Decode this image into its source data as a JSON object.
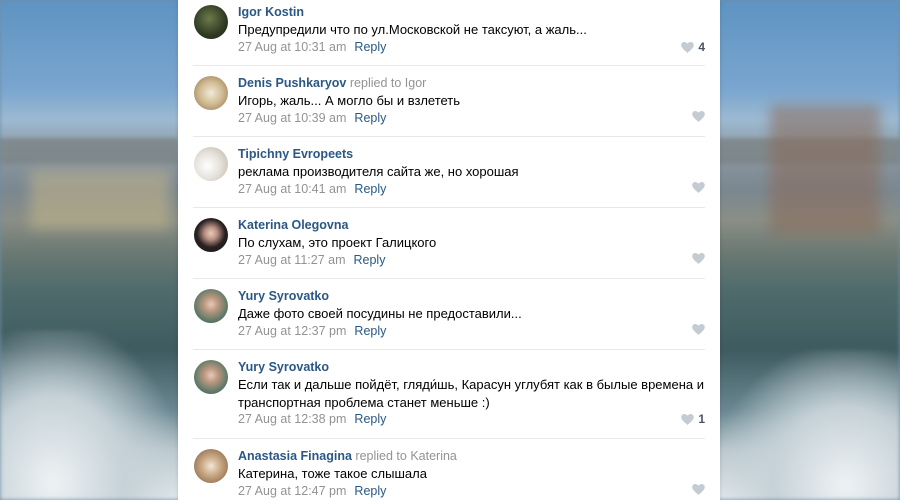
{
  "comments": [
    {
      "author": "Igor Kostin",
      "replied": "",
      "text": "Предупредили что по ул.Московской не таксуют, а жаль...",
      "time": "27 Aug at 10:31 am",
      "reply": "Reply",
      "likes": "4",
      "avatar_color": "#3a4a2a"
    },
    {
      "author": "Denis Pushkaryov",
      "replied": "replied to Igor",
      "text": "Игорь, жаль... А могло бы и взлететь",
      "time": "27 Aug at 10:39 am",
      "reply": "Reply",
      "likes": "",
      "avatar_color": "#b89a6a"
    },
    {
      "author": "Tipichny Evropeets",
      "replied": "",
      "text": "реклама производителя сайта же, но хорошая",
      "time": "27 Aug at 10:41 am",
      "reply": "Reply",
      "likes": "",
      "avatar_color": "#d9d6cf"
    },
    {
      "author": "Katerina Olegovna",
      "replied": "",
      "text": "По слухам, это проект Галицкого",
      "time": "27 Aug at 11:27 am",
      "reply": "Reply",
      "likes": "",
      "avatar_color": "#2b2b2b"
    },
    {
      "author": "Yury Syrovatko",
      "replied": "",
      "text": "Даже фото своей посудины не предоставили...",
      "time": "27 Aug at 12:37 pm",
      "reply": "Reply",
      "likes": "",
      "avatar_color": "#5f7a68"
    },
    {
      "author": "Yury Syrovatko",
      "replied": "",
      "text": "Если так и дальше пойдёт, гляди́шь, Карасун углубят как в былые времена и транспортная проблема станет меньше :)",
      "time": "27 Aug at 12:38 pm",
      "reply": "Reply",
      "likes": "1",
      "avatar_color": "#5f7a68"
    },
    {
      "author": "Anastasia Finagina",
      "replied": "replied to Katerina",
      "text": "Катерина, тоже такое слышала",
      "time": "27 Aug at 12:47 pm",
      "reply": "Reply",
      "likes": "",
      "avatar_color": "#8a6d52"
    }
  ],
  "icons": {
    "like": "heart-icon"
  },
  "colors": {
    "link": "#2a5885",
    "meta": "#939393",
    "panel": "#ffffff"
  }
}
